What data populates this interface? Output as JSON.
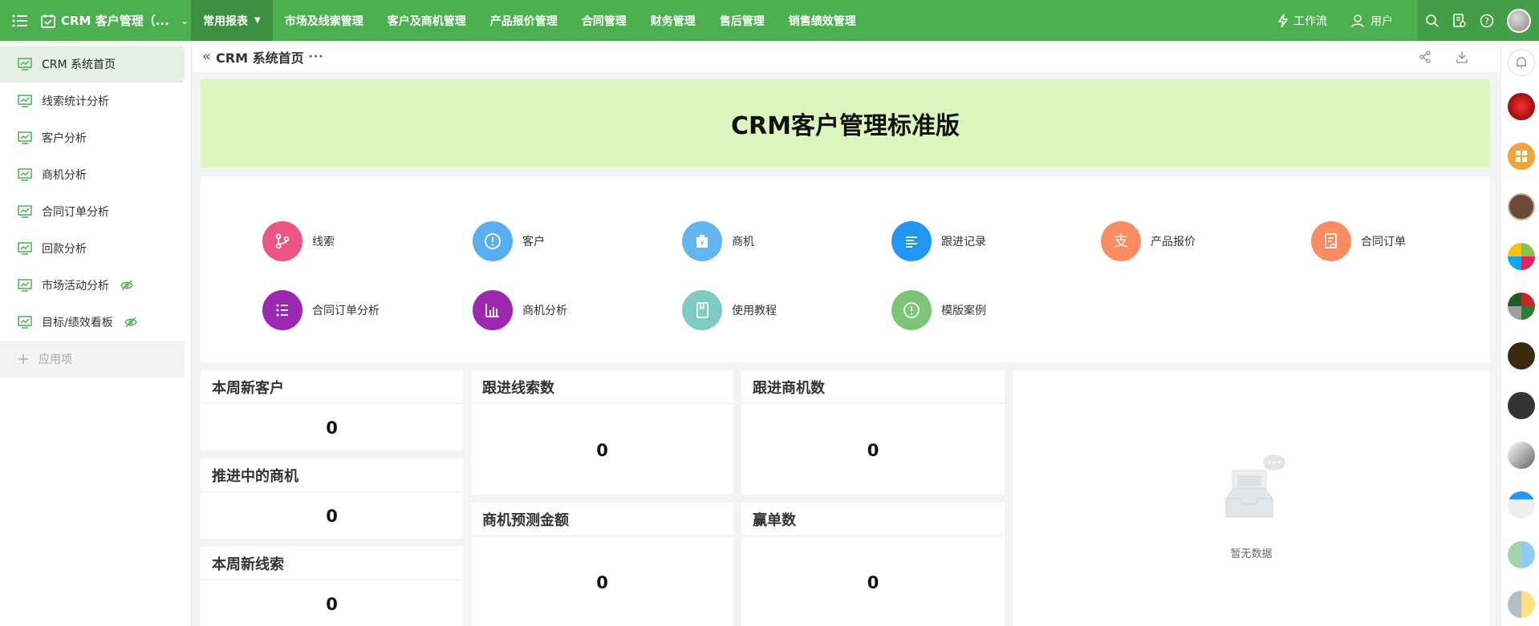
{
  "topbar": {
    "app_title": "CRM 客户管理（...",
    "nav": [
      {
        "label": "常用报表",
        "active": true
      },
      {
        "label": "市场及线索管理"
      },
      {
        "label": "客户及商机管理"
      },
      {
        "label": "产品报价管理"
      },
      {
        "label": "合同管理"
      },
      {
        "label": "财务管理"
      },
      {
        "label": "售后管理"
      },
      {
        "label": "销售绩效管理"
      }
    ],
    "workflow_label": "工作流",
    "user_label": "用户",
    "colors": {
      "bar": "#4caf50",
      "active": "#3d8f41"
    }
  },
  "sidebar": {
    "items": [
      {
        "label": "CRM 系统首页",
        "active": true
      },
      {
        "label": "线索统计分析"
      },
      {
        "label": "客户分析"
      },
      {
        "label": "商机分析"
      },
      {
        "label": "合同订单分析"
      },
      {
        "label": "回款分析"
      },
      {
        "label": "市场活动分析",
        "hidden_icon": true
      },
      {
        "label": "目标/绩效看板",
        "hidden_icon": true
      }
    ],
    "add_label": "应用项"
  },
  "content": {
    "page_title": "CRM 系统首页",
    "more": "···",
    "banner_title": "CRM客户管理标准版"
  },
  "shortcuts": [
    {
      "label": "线索",
      "color": "#ec5484",
      "icon": "branch-icon"
    },
    {
      "label": "客户",
      "color": "#5aaef0",
      "icon": "alert-circle-icon"
    },
    {
      "label": "商机",
      "color": "#64b6f0",
      "icon": "money-bag-icon"
    },
    {
      "label": "跟进记录",
      "color": "#2196f3",
      "icon": "list-lines-icon"
    },
    {
      "label": "产品报价",
      "color": "#f98c63",
      "icon": "alipay-icon"
    },
    {
      "label": "合同订单",
      "color": "#f98c63",
      "icon": "contract-icon"
    },
    {
      "label": "合同订单分析",
      "color": "#9c27b0",
      "icon": "bullet-list-icon"
    },
    {
      "label": "商机分析",
      "color": "#9c27b0",
      "icon": "bar-chart-icon"
    },
    {
      "label": "使用教程",
      "color": "#7fcbc4",
      "icon": "book-icon"
    },
    {
      "label": "模版案例",
      "color": "#7cc576",
      "icon": "alert-circle-icon"
    }
  ],
  "stats": {
    "weekly_new_customers": {
      "title": "本周新客户",
      "value": "0"
    },
    "followed_leads": {
      "title": "跟进线索数",
      "value": "0"
    },
    "followed_opps": {
      "title": "跟进商机数",
      "value": "0"
    },
    "opps_in_progress": {
      "title": "推进中的商机",
      "value": "0"
    },
    "opp_forecast": {
      "title": "商机预测金额",
      "value": "0"
    },
    "won_deals": {
      "title": "赢单数",
      "value": "0"
    },
    "weekly_new_leads": {
      "title": "本周新线索",
      "value": "0"
    }
  },
  "empty_state": {
    "text": "暂无数据"
  }
}
